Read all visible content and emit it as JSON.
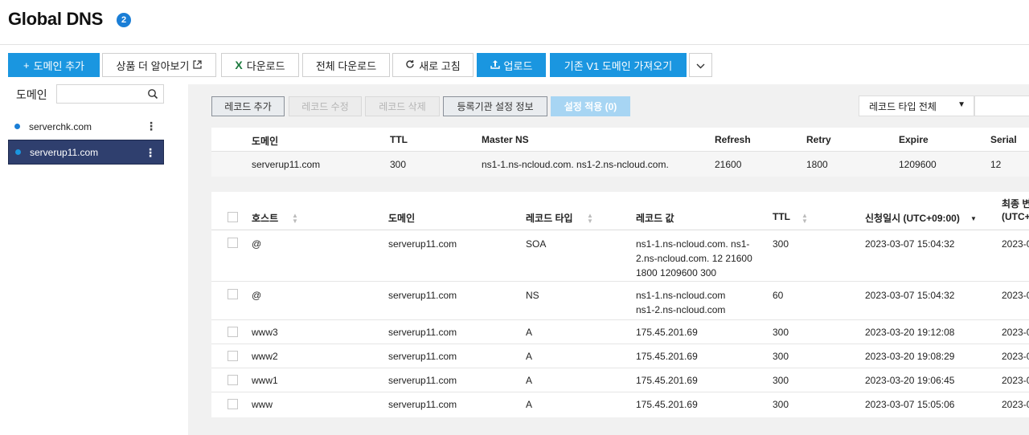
{
  "header": {
    "title": "Global DNS",
    "badge": "2"
  },
  "toolbar": {
    "add_domain": "도메인 추가",
    "learn_more": "상품 더 알아보기",
    "download": "다운로드",
    "download_all": "전체 다운로드",
    "refresh": "새로 고침",
    "upload": "업로드",
    "import_v1": "기존 V1 도메인 가져오기"
  },
  "sidebar": {
    "label": "도메인",
    "search_placeholder": "",
    "items": [
      {
        "label": "serverchk.com",
        "active": false
      },
      {
        "label": "serverup11.com",
        "active": true
      }
    ]
  },
  "record_actions": {
    "add": "레코드 추가",
    "edit": "레코드 수정",
    "delete": "레코드 삭제",
    "registrar": "등록기관 설정 정보",
    "apply": "설정 적용 (0)"
  },
  "filter": {
    "record_type": "레코드 타입 전체"
  },
  "soa_table": {
    "headers": [
      "도메인",
      "TTL",
      "Master NS",
      "Refresh",
      "Retry",
      "Expire",
      "Serial"
    ],
    "row": [
      "serverup11.com",
      "300",
      "ns1-1.ns-ncloud.com. ns1-2.ns-ncloud.com.",
      "21600",
      "1800",
      "1209600",
      "12"
    ]
  },
  "records_table": {
    "headers": [
      "호스트",
      "도메인",
      "레코드 타입",
      "레코드 값",
      "TTL",
      "신청일시 (UTC+09:00)",
      "최종 변",
      "(UTC+"
    ],
    "rows": [
      {
        "host": "@",
        "domain": "serverup11.com",
        "type": "SOA",
        "value_lines": [
          "ns1-1.ns-ncloud.com. ns1-",
          "2.ns-ncloud.com. 12 21600",
          "1800 1209600 300"
        ],
        "ttl": "300",
        "created": "2023-03-07 15:04:32",
        "updated": "2023-0"
      },
      {
        "host": "@",
        "domain": "serverup11.com",
        "type": "NS",
        "value_lines": [
          "ns1-1.ns-ncloud.com",
          "ns1-2.ns-ncloud.com"
        ],
        "ttl": "60",
        "created": "2023-03-07 15:04:32",
        "updated": "2023-0"
      },
      {
        "host": "www3",
        "domain": "serverup11.com",
        "type": "A",
        "value_lines": [
          "175.45.201.69"
        ],
        "ttl": "300",
        "created": "2023-03-20 19:12:08",
        "updated": "2023-0"
      },
      {
        "host": "www2",
        "domain": "serverup11.com",
        "type": "A",
        "value_lines": [
          "175.45.201.69"
        ],
        "ttl": "300",
        "created": "2023-03-20 19:08:29",
        "updated": "2023-0"
      },
      {
        "host": "www1",
        "domain": "serverup11.com",
        "type": "A",
        "value_lines": [
          "175.45.201.69"
        ],
        "ttl": "300",
        "created": "2023-03-20 19:06:45",
        "updated": "2023-0"
      },
      {
        "host": "www",
        "domain": "serverup11.com",
        "type": "A",
        "value_lines": [
          "175.45.201.69"
        ],
        "ttl": "300",
        "created": "2023-03-07 15:05:06",
        "updated": "2023-0"
      }
    ]
  },
  "colors": {
    "primary": "#1a96e0",
    "active_domain": "#2f3f6e",
    "badge": "#1a7ed6"
  }
}
